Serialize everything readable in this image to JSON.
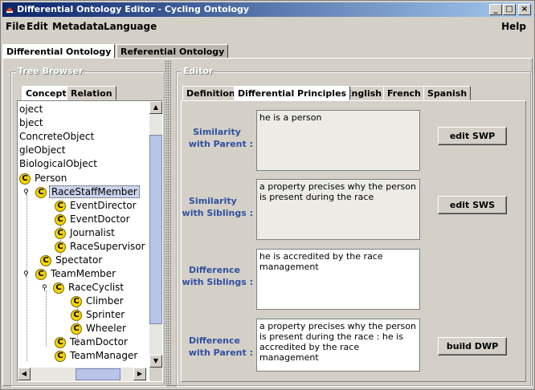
{
  "window": {
    "title": "Differential Ontology Editor - Cycling Ontology"
  },
  "menu": {
    "file": "File",
    "edit": "Edit",
    "metadata": "Metadata",
    "language": "Language",
    "help": "Help"
  },
  "outer_tabs": [
    "Differential Ontology",
    "Referential Ontology"
  ],
  "tree_browser": {
    "title": "Tree Browser",
    "tabs": [
      "Concept",
      "Relation"
    ],
    "rows": [
      "oject",
      "bject",
      "ConcreteObject",
      "gleObject",
      "BiologicalObject",
      "Person",
      "RaceStaffMember",
      "EventDirector",
      "EventDoctor",
      "Journalist",
      "RaceSupervisor",
      "Spectator",
      "TeamMember",
      "RaceCyclist",
      "Climber",
      "Sprinter",
      "Wheeler",
      "TeamDoctor",
      "TeamManager"
    ],
    "selected": "RaceStaffMember"
  },
  "editor": {
    "title": "Editor",
    "tabs": [
      "Definition",
      "Differential Principles",
      "English",
      "French",
      "Spanish"
    ],
    "active_tab": "Differential Principles",
    "fields": [
      {
        "label_1": "Similarity",
        "label_2": "with Parent :",
        "text": "he is a person",
        "button": "edit SWP"
      },
      {
        "label_1": "Similarity",
        "label_2": "with Siblings :",
        "text": "a property precises why the person\nis present during the race",
        "button": "edit SWS"
      },
      {
        "label_1": "Difference",
        "label_2": "with Siblings :",
        "text": "he is accredited by the race\nmanagement",
        "button": ""
      },
      {
        "label_1": "Difference",
        "label_2": "with Parent :",
        "text": "a property precises why the person\nis present during the race : he is\naccredited by the race management",
        "button": "build DWP"
      }
    ]
  },
  "colors": {
    "title_bar": "#0a246a",
    "label_blue": "#3050a0",
    "concept_icon": "#f5d400",
    "selection": "#ccd4ec"
  },
  "icons": [
    "app-icon",
    "minimize-icon",
    "maximize-icon",
    "close-icon",
    "concept-icon",
    "expand-handle-icon",
    "scroll-up-icon",
    "scroll-down-icon",
    "scroll-left-icon",
    "scroll-right-icon"
  ]
}
